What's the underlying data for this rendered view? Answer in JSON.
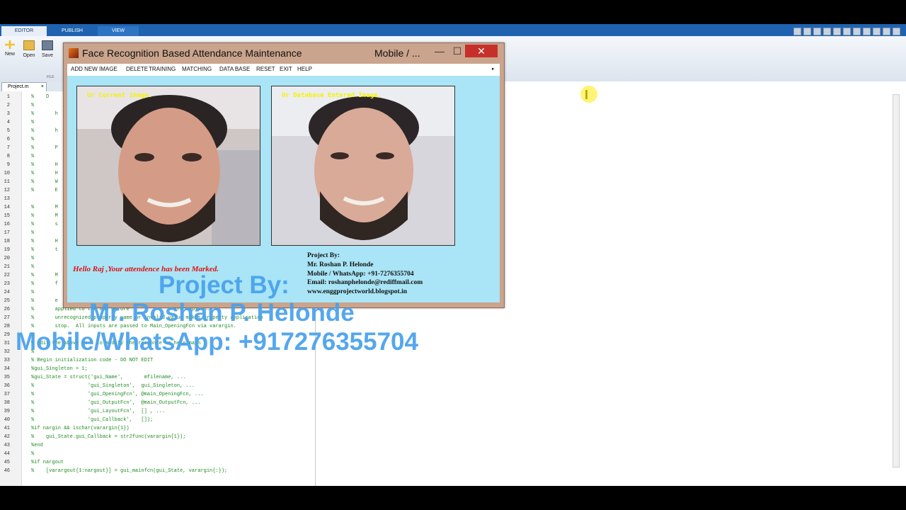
{
  "ribbon": {
    "tabs": [
      "EDITOR",
      "PUBLISH",
      "VIEW"
    ],
    "tools": [
      "New",
      "Open",
      "Save"
    ],
    "section_label": "FILE"
  },
  "editor": {
    "file_tab": "Project.m",
    "close_glyph": "×",
    "code_lines": [
      {
        "n": "1",
        "t": "%    D"
      },
      {
        "n": "2",
        "t": "%"
      },
      {
        "n": "3",
        "t": "%       h"
      },
      {
        "n": "4",
        "t": "%"
      },
      {
        "n": "5",
        "t": "%       h"
      },
      {
        "n": "6",
        "t": "%"
      },
      {
        "n": "7",
        "t": "%       P"
      },
      {
        "n": "8",
        "t": "%"
      },
      {
        "n": "9",
        "t": "%       H"
      },
      {
        "n": "10",
        "t": "%       H"
      },
      {
        "n": "11",
        "t": "%       W"
      },
      {
        "n": "12",
        "t": "%       E"
      },
      {
        "n": "13",
        "t": ""
      },
      {
        "n": "14",
        "t": "%       M"
      },
      {
        "n": "15",
        "t": "%       M"
      },
      {
        "n": "16",
        "t": "%       s"
      },
      {
        "n": "17",
        "t": "%"
      },
      {
        "n": "18",
        "t": "%       H"
      },
      {
        "n": "19",
        "t": "%       t"
      },
      {
        "n": "20",
        "t": "%"
      },
      {
        "n": "21",
        "t": "%"
      },
      {
        "n": "22",
        "t": "%       M"
      },
      {
        "n": "23",
        "t": "%       f"
      },
      {
        "n": "24",
        "t": "%"
      },
      {
        "n": "25",
        "t": "%       e"
      },
      {
        "n": "26",
        "t": "%       applied to the GUI before               are applied.  A"
      },
      {
        "n": "27",
        "t": "%       unrecognized property name or invalid value makes property application"
      },
      {
        "n": "28",
        "t": "%       stop.  All inputs are passed to Main_OpeningFcn via varargin."
      },
      {
        "n": "29",
        "t": "%"
      },
      {
        "n": "31",
        "t": "% Edit the above text to modify the response to help main"
      },
      {
        "n": "32",
        "t": "%"
      },
      {
        "n": "33",
        "t": "% Begin initialization code - DO NOT EDIT"
      },
      {
        "n": "34",
        "t": "%gui_Singleton = 1;"
      },
      {
        "n": "35",
        "t": "%gui_State = struct('gui_Name',       mfilename, ..."
      },
      {
        "n": "36",
        "t": "%                  'gui_Singleton',  gui_Singleton, ..."
      },
      {
        "n": "37",
        "t": "%                  'gui_OpeningFcn', @main_OpeningFcn, ..."
      },
      {
        "n": "38",
        "t": "%                  'gui_OutputFcn',  @main_OutputFcn, ..."
      },
      {
        "n": "39",
        "t": "%                  'gui_LayoutFcn',  [] , ..."
      },
      {
        "n": "40",
        "t": "%                  'gui_Callback',   []);"
      },
      {
        "n": "41",
        "t": "%if nargin && ischar(varargin{1})"
      },
      {
        "n": "42",
        "t": "%    gui_State.gui_Callback = str2func(varargin{1});"
      },
      {
        "n": "43",
        "t": "%end"
      },
      {
        "n": "44",
        "t": "%"
      },
      {
        "n": "45",
        "t": "%if nargout"
      },
      {
        "n": "46",
        "t": "%    [varargout{1:nargout}] = gui_mainfcn(gui_State, varargin{:});"
      }
    ]
  },
  "dialog": {
    "title": "Face Recognition Based Attendance Maintenance",
    "title_extra": "Mobile / ...",
    "minimize": "—",
    "maximize": "☐",
    "close": "✕",
    "menu": [
      "ADD NEW IMAGE",
      "DELETE",
      "TRAINING",
      "MATCHING",
      "DATA BASE",
      "RESET",
      "EXIT",
      "HELP"
    ],
    "menu_arrow": "▸",
    "current_caption": "Ur Current image.",
    "database_caption": "Ur Database Entered Image.",
    "status_message": "Hello Raj ,Your attendence has been Marked.",
    "credits": [
      "Project By:",
      "Mr. Roshan P. Helonde",
      "Mobile / WhatsApp: +91-7276355704",
      "Email: roshanphelonde@rediffmail.com",
      "www.enggprojectworld.blogspot.in"
    ]
  },
  "watermark": {
    "line1": "Project By:",
    "line2": "Mr. Roshan P. Helonde",
    "line3": "Mobile/WhatsApp: +917276355704"
  },
  "cursor_glyph": "I"
}
